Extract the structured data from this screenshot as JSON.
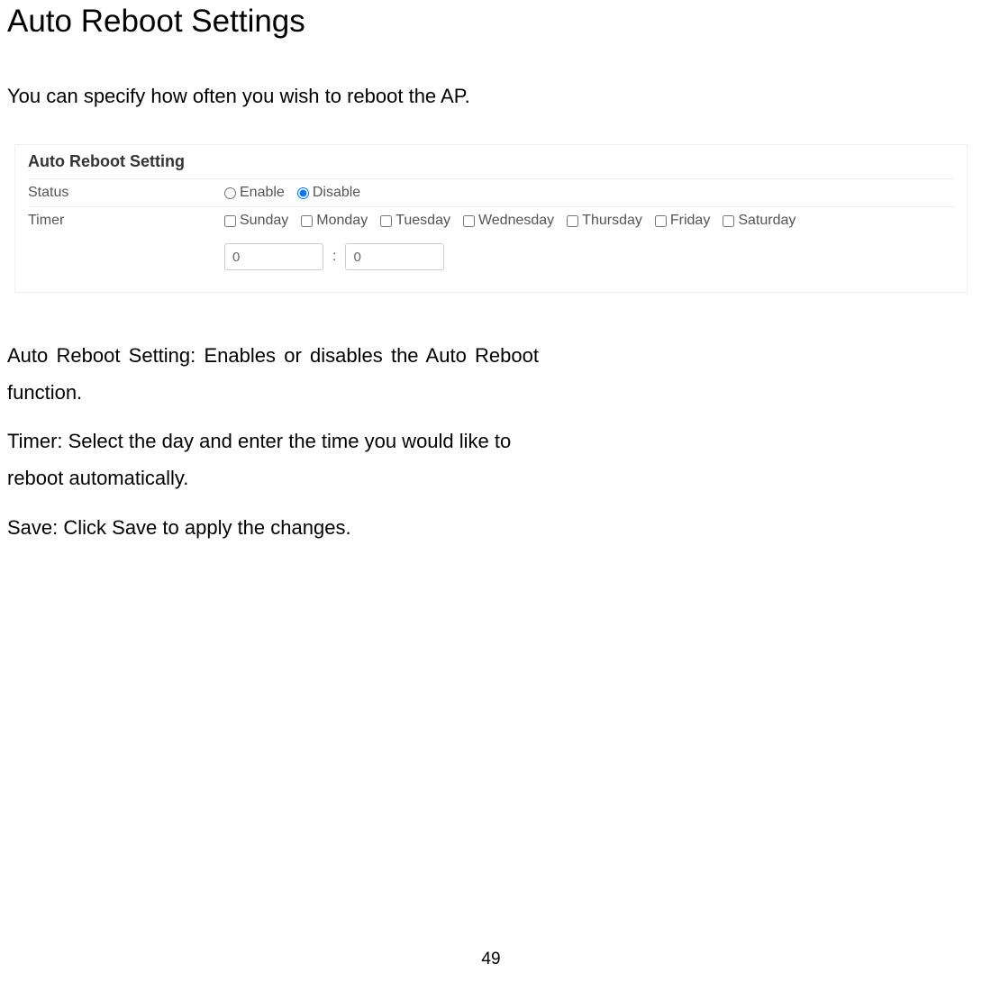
{
  "page": {
    "title": "Auto Reboot Settings",
    "intro": "You can specify how often you wish to reboot the AP.",
    "page_number": "49"
  },
  "panel": {
    "heading": "Auto Reboot Setting",
    "status_label": "Status",
    "enable_label": "Enable",
    "disable_label": "Disable",
    "timer_label": "Timer",
    "days": {
      "sunday": "Sunday",
      "monday": "Monday",
      "tuesday": "Tuesday",
      "wednesday": "Wednesday",
      "thursday": "Thursday",
      "friday": "Friday",
      "saturday": "Saturday"
    },
    "hour_value": "0",
    "minute_value": "0",
    "colon": ":"
  },
  "descriptions": {
    "d1": "Auto Reboot Setting: Enables or disables the Auto Reboot function.",
    "d2": "Timer: Select the day and enter the time you would like to reboot automatically.",
    "d3": "Save: Click Save to apply the changes."
  }
}
